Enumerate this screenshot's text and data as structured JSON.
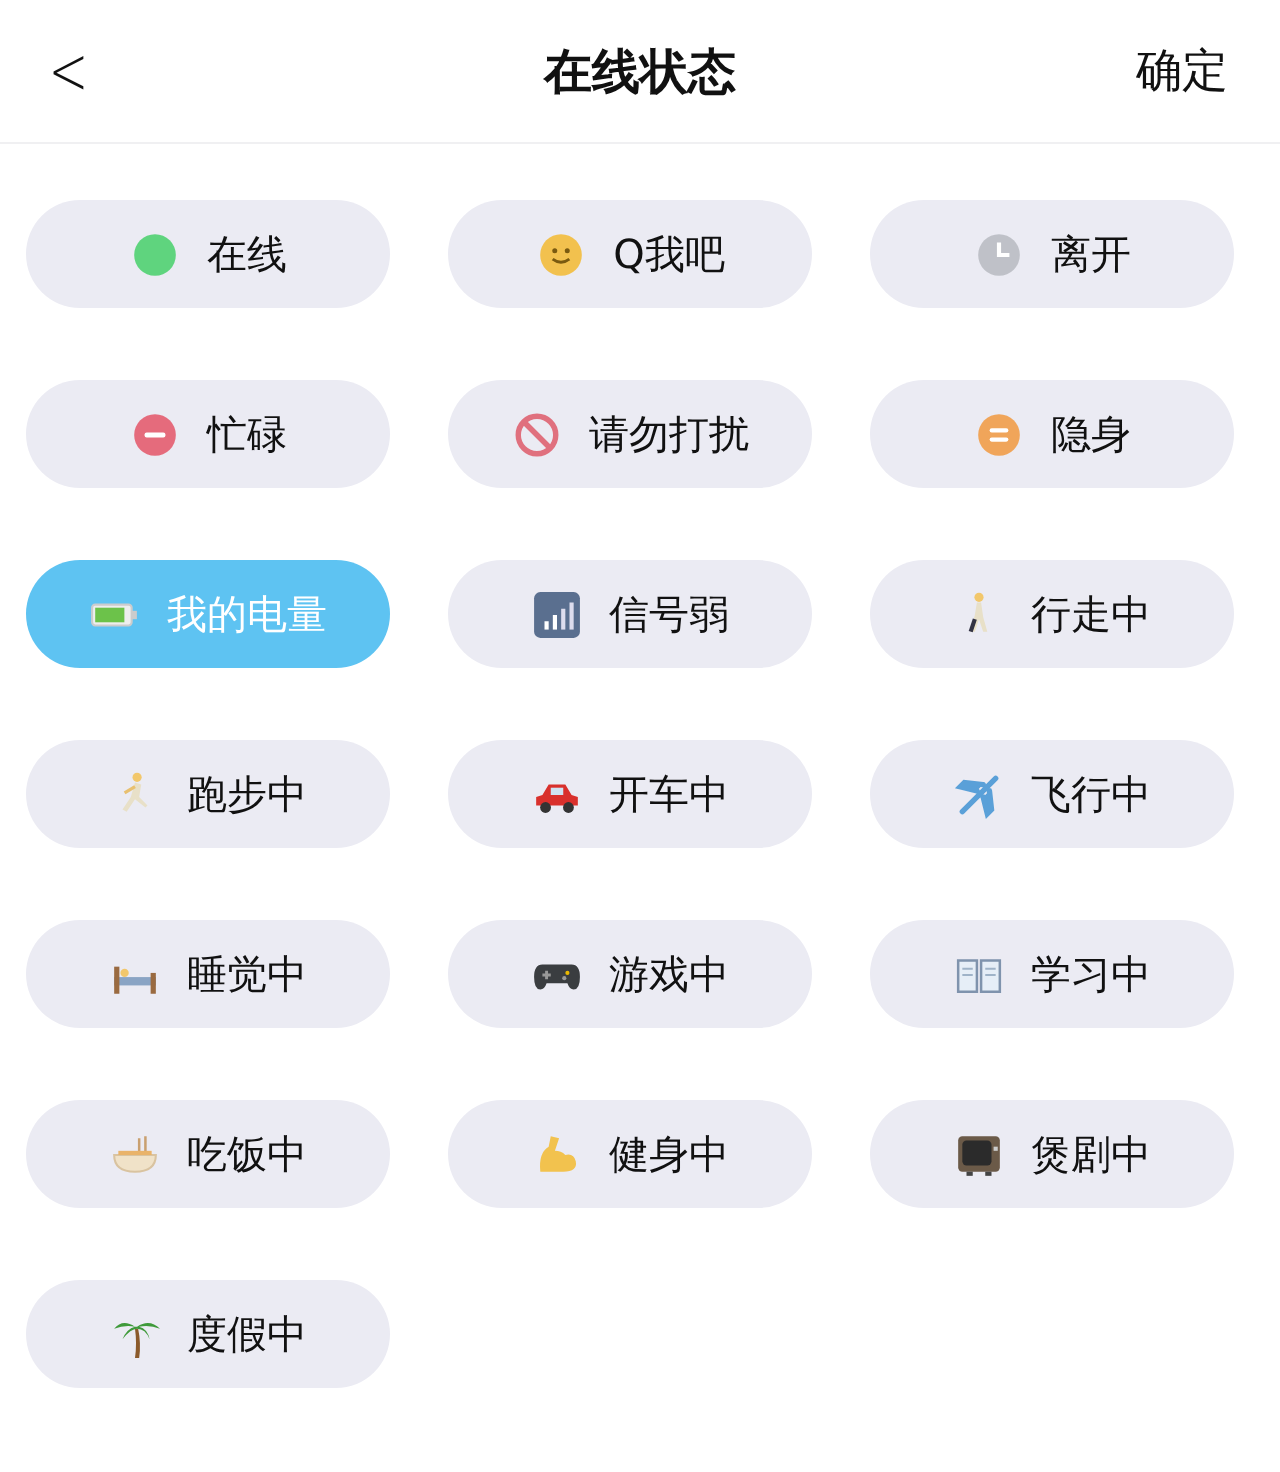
{
  "header": {
    "back": "<",
    "title": "在线状态",
    "confirm": "确定"
  },
  "statuses": [
    {
      "label": "在线",
      "selected": false
    },
    {
      "label": "Q我吧",
      "selected": false
    },
    {
      "label": "离开",
      "selected": false
    },
    {
      "label": "忙碌",
      "selected": false
    },
    {
      "label": "请勿打扰",
      "selected": false
    },
    {
      "label": "隐身",
      "selected": false
    },
    {
      "label": "我的电量",
      "selected": true
    },
    {
      "label": "信号弱",
      "selected": false
    },
    {
      "label": "行走中",
      "selected": false
    },
    {
      "label": "跑步中",
      "selected": false
    },
    {
      "label": "开车中",
      "selected": false
    },
    {
      "label": "飞行中",
      "selected": false
    },
    {
      "label": "睡觉中",
      "selected": false
    },
    {
      "label": "游戏中",
      "selected": false
    },
    {
      "label": "学习中",
      "selected": false
    },
    {
      "label": "吃饭中",
      "selected": false
    },
    {
      "label": "健身中",
      "selected": false
    },
    {
      "label": "煲剧中",
      "selected": false
    },
    {
      "label": "度假中",
      "selected": false
    }
  ]
}
